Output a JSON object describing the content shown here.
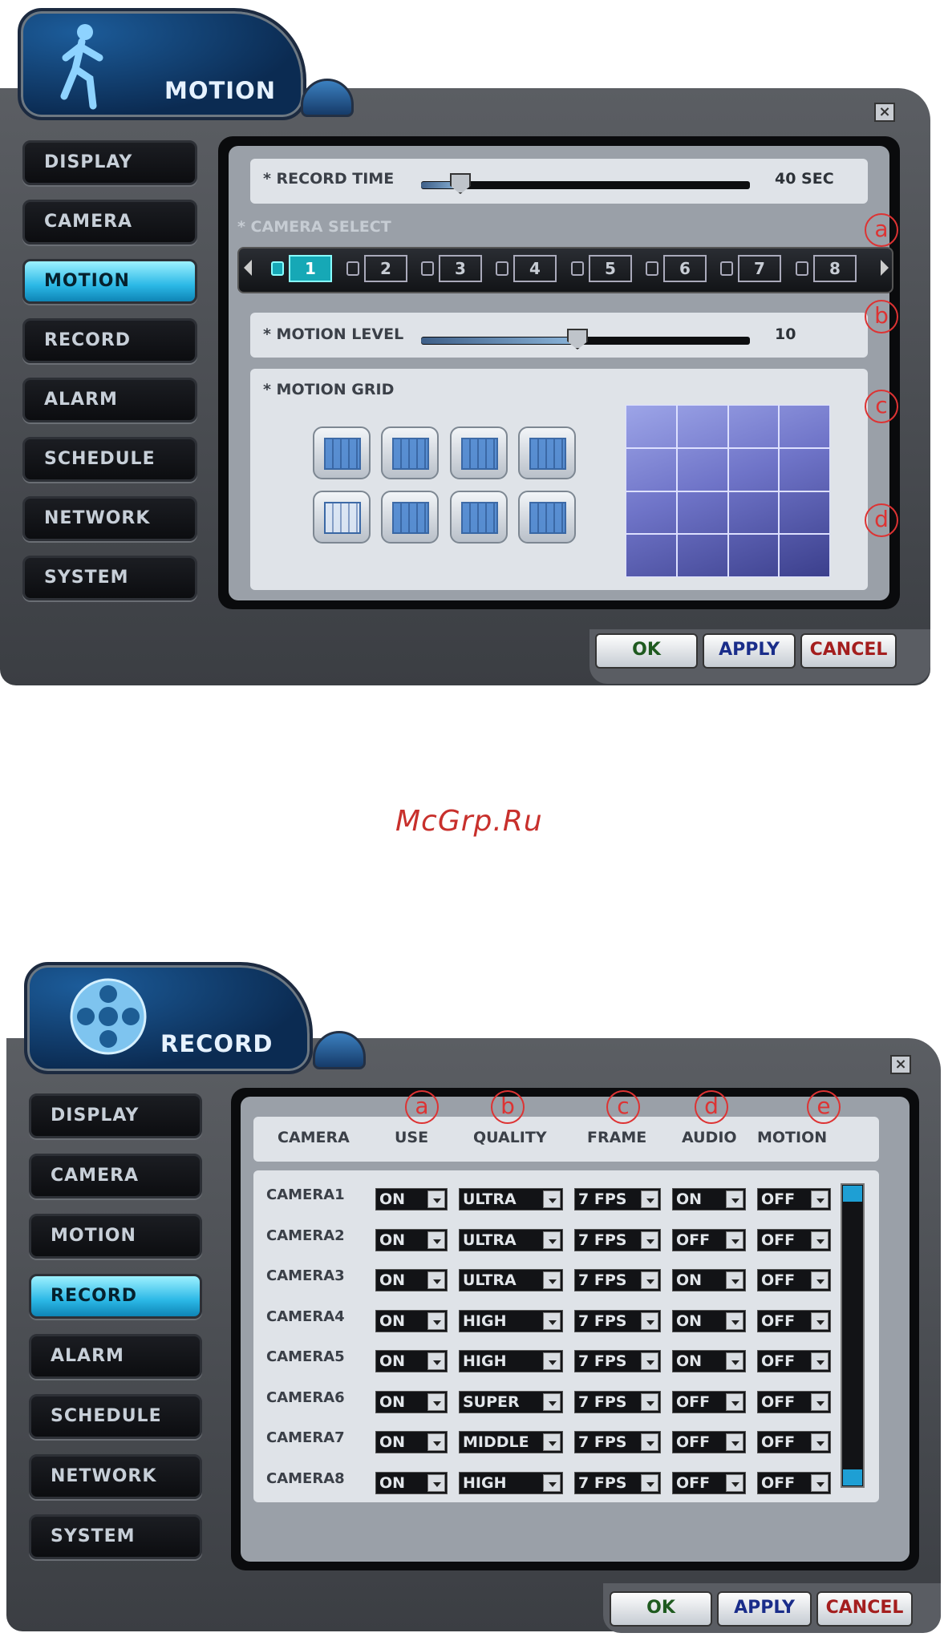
{
  "watermark": "McGrp.Ru",
  "motion_window": {
    "title": "MOTION",
    "close_label": "×",
    "nav": [
      "DISPLAY",
      "CAMERA",
      "MOTION",
      "RECORD",
      "ALARM",
      "SCHEDULE",
      "NETWORK",
      "SYSTEM"
    ],
    "active_nav": "MOTION",
    "record_time": {
      "label": "* RECORD TIME",
      "value": "40 SEC"
    },
    "camera_select": {
      "label": "* CAMERA SELECT",
      "cameras": [
        "1",
        "2",
        "3",
        "4",
        "5",
        "6",
        "7",
        "8"
      ],
      "selected": "1"
    },
    "motion_level": {
      "label": "* MOTION LEVEL",
      "value": "10"
    },
    "motion_grid": {
      "label": "* MOTION GRID"
    },
    "callouts": [
      "a",
      "b",
      "c",
      "d"
    ],
    "buttons": {
      "ok": "OK",
      "apply": "APPLY",
      "cancel": "CANCEL"
    }
  },
  "record_window": {
    "title": "RECORD",
    "close_label": "×",
    "nav": [
      "DISPLAY",
      "CAMERA",
      "MOTION",
      "RECORD",
      "ALARM",
      "SCHEDULE",
      "NETWORK",
      "SYSTEM"
    ],
    "active_nav": "RECORD",
    "columns": [
      "CAMERA",
      "USE",
      "QUALITY",
      "FRAME",
      "AUDIO",
      "MOTION"
    ],
    "callouts": [
      "a",
      "b",
      "c",
      "d",
      "e"
    ],
    "rows": [
      {
        "camera": "CAMERA1",
        "use": "ON",
        "quality": "ULTRA",
        "frame": "7 FPS",
        "audio": "ON",
        "motion": "OFF"
      },
      {
        "camera": "CAMERA2",
        "use": "ON",
        "quality": "ULTRA",
        "frame": "7 FPS",
        "audio": "OFF",
        "motion": "OFF"
      },
      {
        "camera": "CAMERA3",
        "use": "ON",
        "quality": "ULTRA",
        "frame": "7 FPS",
        "audio": "ON",
        "motion": "OFF"
      },
      {
        "camera": "CAMERA4",
        "use": "ON",
        "quality": "HIGH",
        "frame": "7 FPS",
        "audio": "ON",
        "motion": "OFF"
      },
      {
        "camera": "CAMERA5",
        "use": "ON",
        "quality": "HIGH",
        "frame": "7 FPS",
        "audio": "ON",
        "motion": "OFF"
      },
      {
        "camera": "CAMERA6",
        "use": "ON",
        "quality": "SUPER",
        "frame": "7 FPS",
        "audio": "OFF",
        "motion": "OFF"
      },
      {
        "camera": "CAMERA7",
        "use": "ON",
        "quality": "MIDDLE",
        "frame": "7 FPS",
        "audio": "OFF",
        "motion": "OFF"
      },
      {
        "camera": "CAMERA8",
        "use": "ON",
        "quality": "HIGH",
        "frame": "7 FPS",
        "audio": "OFF",
        "motion": "OFF"
      }
    ],
    "buttons": {
      "ok": "OK",
      "apply": "APPLY",
      "cancel": "CANCEL"
    }
  }
}
